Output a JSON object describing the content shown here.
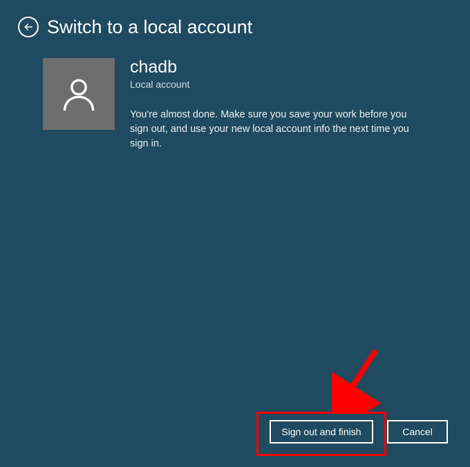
{
  "header": {
    "title": "Switch to a local account"
  },
  "user": {
    "name": "chadb",
    "account_type": "Local account"
  },
  "description": "You're almost done. Make sure you save your work before you sign out, and use your new local account info the next time you sign in.",
  "buttons": {
    "primary": "Sign out and finish",
    "cancel": "Cancel"
  }
}
